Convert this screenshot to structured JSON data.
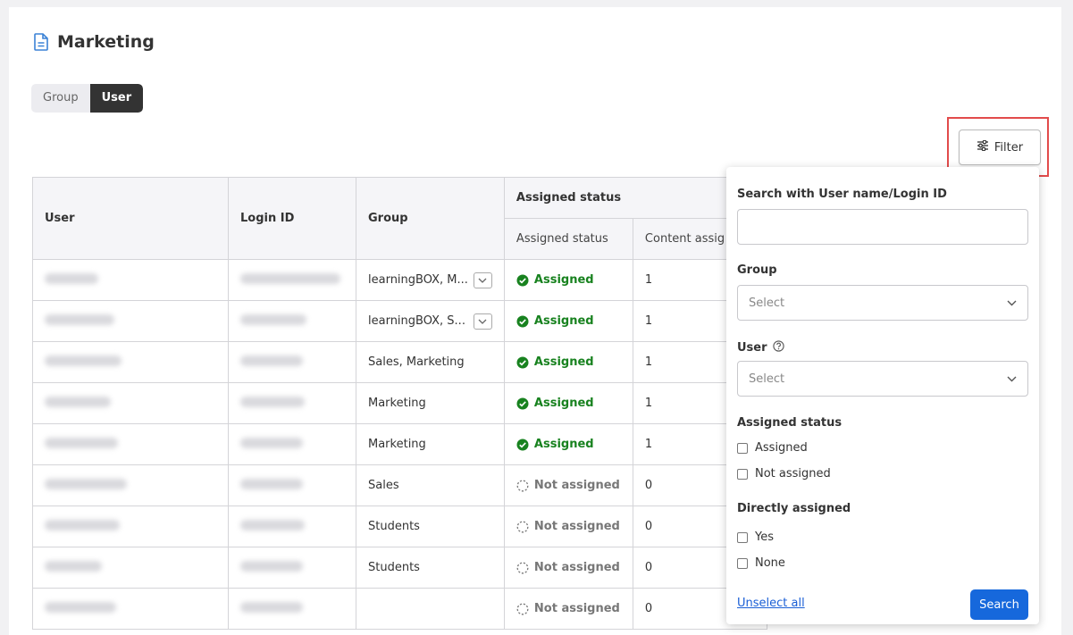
{
  "page": {
    "title": "Marketing"
  },
  "view_toggle": {
    "group_label": "Group",
    "user_label": "User",
    "active": "User"
  },
  "toolbar": {
    "filter_label": "Filter"
  },
  "table": {
    "headers": {
      "user": "User",
      "login_id": "Login ID",
      "group": "Group",
      "assigned_status_group": "Assigned status",
      "assigned_status": "Assigned status",
      "content_assigned": "Content assig"
    },
    "rows": [
      {
        "group": "learningBOX, M...",
        "has_dropdown": true,
        "status": "Assigned",
        "assigned": true,
        "count": "1"
      },
      {
        "group": "learningBOX, S...",
        "has_dropdown": true,
        "status": "Assigned",
        "assigned": true,
        "count": "1"
      },
      {
        "group": "Sales, Marketing",
        "has_dropdown": false,
        "status": "Assigned",
        "assigned": true,
        "count": "1"
      },
      {
        "group": "Marketing",
        "has_dropdown": false,
        "status": "Assigned",
        "assigned": true,
        "count": "1"
      },
      {
        "group": "Marketing",
        "has_dropdown": false,
        "status": "Assigned",
        "assigned": true,
        "count": "1"
      },
      {
        "group": "Sales",
        "has_dropdown": false,
        "status": "Not assigned",
        "assigned": false,
        "count": "0"
      },
      {
        "group": "Students",
        "has_dropdown": false,
        "status": "Not assigned",
        "assigned": false,
        "count": "0"
      },
      {
        "group": "Students",
        "has_dropdown": false,
        "status": "Not assigned",
        "assigned": false,
        "count": "0"
      },
      {
        "group": "",
        "has_dropdown": false,
        "status": "Not assigned",
        "assigned": false,
        "count": "0"
      }
    ]
  },
  "filter_panel": {
    "search_label": "Search with User name/Login ID",
    "search_value": "",
    "group_label": "Group",
    "group_placeholder": "Select",
    "user_label": "User",
    "user_placeholder": "Select",
    "assigned_status_label": "Assigned status",
    "assigned_options": [
      "Assigned",
      "Not assigned"
    ],
    "directly_assigned_label": "Directly assigned",
    "direct_options": [
      "Yes",
      "None"
    ],
    "unselect_all": "Unselect all",
    "search_button": "Search"
  },
  "colors": {
    "assigned": "#18821f",
    "not_assigned": "#777777",
    "primary": "#1668dc",
    "highlight": "#e24b4b",
    "active_toggle": "#333333"
  }
}
